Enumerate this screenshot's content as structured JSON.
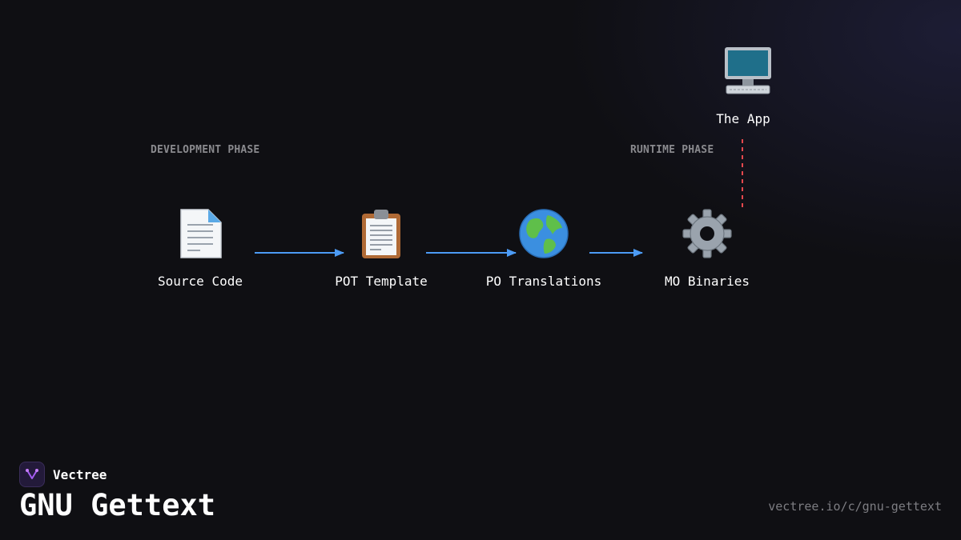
{
  "phases": {
    "development": "DEVELOPMENT PHASE",
    "runtime": "RUNTIME PHASE"
  },
  "nodes": {
    "source_code": {
      "label": "Source Code",
      "icon": "document-icon"
    },
    "pot_template": {
      "label": "POT Template",
      "icon": "clipboard-icon"
    },
    "po_translations": {
      "label": "PO Translations",
      "icon": "globe-icon"
    },
    "mo_binaries": {
      "label": "MO Binaries",
      "icon": "gear-icon"
    },
    "the_app": {
      "label": "The App",
      "icon": "computer-icon"
    }
  },
  "colors": {
    "arrow": "#4c9bf5",
    "runtime_link": "#e5484d",
    "background": "#0f0f13"
  },
  "brand": {
    "name": "Vectree"
  },
  "title": "GNU Gettext",
  "url": "vectree.io/c/gnu-gettext"
}
